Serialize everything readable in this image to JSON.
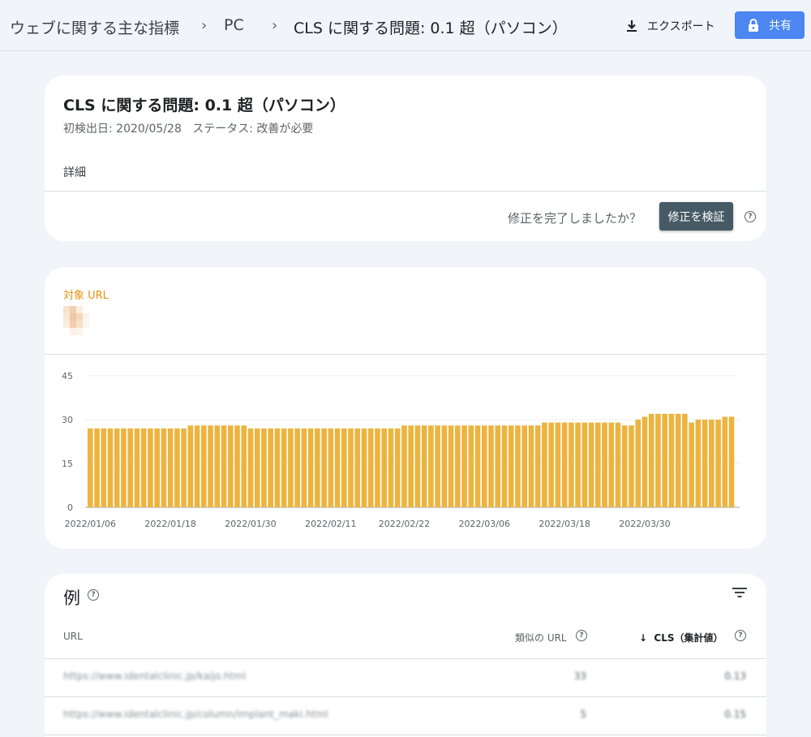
{
  "header": {
    "breadcrumb": [
      "ウェブに関する主な指標",
      "PC",
      "CLS に関する問題: 0.1 超（パソコン）"
    ],
    "export_label": "エクスポート",
    "share_label": "共有"
  },
  "issue": {
    "title": "CLS に関する問題: 0.1 超（パソコン）",
    "first_detected": "初検出日: 2020/05/28",
    "status": "ステータス: 改善が必要",
    "details_label": "詳細",
    "fix_question": "修正を完了しましたか？",
    "validate_button": "修正を検証"
  },
  "metric": {
    "label": "対象 URL",
    "label_color": "#e8910c"
  },
  "chart_data": {
    "type": "bar",
    "color": "#ecb43f",
    "ylim": [
      0,
      45
    ],
    "yticks": [
      0,
      15,
      30,
      45
    ],
    "xtick_labels": [
      "2022/01/06",
      "2022/01/18",
      "2022/01/30",
      "2022/02/11",
      "2022/02/22",
      "2022/03/06",
      "2022/03/18",
      "2022/03/30"
    ],
    "xtick_indices": [
      0,
      12,
      24,
      36,
      47,
      59,
      71,
      83
    ],
    "grid": true,
    "values": [
      27,
      27,
      27,
      27,
      27,
      27,
      27,
      27,
      27,
      27,
      27,
      27,
      27,
      27,
      27,
      28,
      28,
      28,
      28,
      28,
      28,
      28,
      28,
      28,
      27,
      27,
      27,
      27,
      27,
      27,
      27,
      27,
      27,
      27,
      27,
      27,
      27,
      27,
      27,
      27,
      27,
      27,
      27,
      27,
      27,
      27,
      27,
      28,
      28,
      28,
      28,
      28,
      28,
      28,
      28,
      28,
      28,
      28,
      28,
      28,
      28,
      28,
      28,
      28,
      28,
      28,
      28,
      28,
      29,
      29,
      29,
      29,
      29,
      29,
      29,
      29,
      29,
      29,
      29,
      29,
      28,
      28,
      30,
      31,
      32,
      32,
      32,
      32,
      32,
      32,
      29,
      30,
      30,
      30,
      30,
      31,
      31
    ]
  },
  "examples": {
    "title": "例",
    "columns": {
      "url": "URL",
      "similar": "類似の URL",
      "cls": "CLS（集計値）",
      "sort_arrow": "↓"
    },
    "rows": [
      {
        "url": "https://www.identalclinic.jp/kaijo.html",
        "similar": "33",
        "cls": "0.13"
      },
      {
        "url": "https://www.identalclinic.jp/column/implant_maki.html",
        "similar": "5",
        "cls": "0.15"
      }
    ]
  },
  "icons": {
    "help": "?",
    "download": "download-icon",
    "lock": "lock-icon",
    "filter": "filter-icon"
  }
}
